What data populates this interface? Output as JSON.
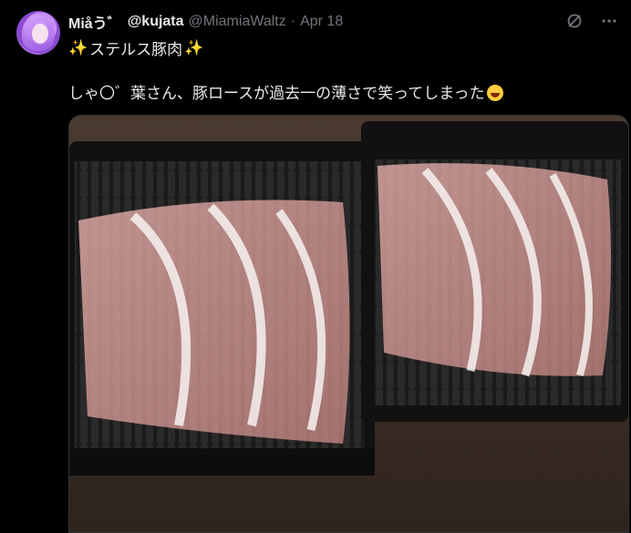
{
  "tweet": {
    "display_name": "Miåう゛",
    "handle_bold": "@kujata",
    "handle": "@MiamiaWaltz",
    "separator": "·",
    "date": "Apr 18",
    "title": "ステルス豚肉",
    "title_emoji": "✨",
    "body": "しゃ〇゛葉さん、豚ロースが過去一の薄さで笑ってしまった",
    "body_emoji": "face-with-tears-of-joy"
  },
  "icons": {
    "grok": "grok-icon",
    "more": "more-icon"
  },
  "colors": {
    "background": "#000000",
    "text": "#e7e9ea",
    "muted": "#71767b",
    "sparkle": "#ffd54a"
  }
}
